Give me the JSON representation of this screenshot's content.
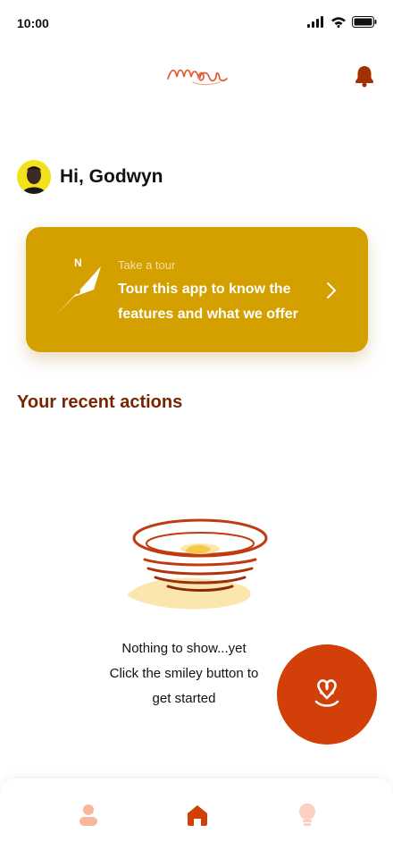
{
  "status_bar": {
    "time": "10:00",
    "icons": [
      "signal-icon",
      "wifi-icon",
      "battery-icon"
    ]
  },
  "header": {
    "logo": "app-logo",
    "notification_icon": "bell-icon"
  },
  "greeting": {
    "text": "Hi, Godwyn",
    "avatar": "user-avatar"
  },
  "tour_card": {
    "eyebrow": "Take a tour",
    "title": "Tour this app to know the features and what we offer",
    "compass_label": "N",
    "icon": "compass-icon",
    "action_icon": "chevron-right-icon"
  },
  "recent_actions": {
    "title": "Your recent actions",
    "empty_line_1": "Nothing to show...yet",
    "empty_line_2": "Click the smiley button to",
    "empty_line_3": "get started",
    "illustration": "empty-bowl-illustration"
  },
  "fab": {
    "icon": "smiley-pretzel-icon"
  },
  "bottom_nav": {
    "items": [
      {
        "name": "profile",
        "icon": "person-icon"
      },
      {
        "name": "home",
        "icon": "home-icon",
        "active": true
      },
      {
        "name": "ideas",
        "icon": "lightbulb-icon"
      }
    ]
  },
  "colors": {
    "accent_orange": "#d23f08",
    "card_gold": "#d4a000",
    "heading_brown": "#7a2500",
    "nav_inactive": "#f7b79a"
  }
}
